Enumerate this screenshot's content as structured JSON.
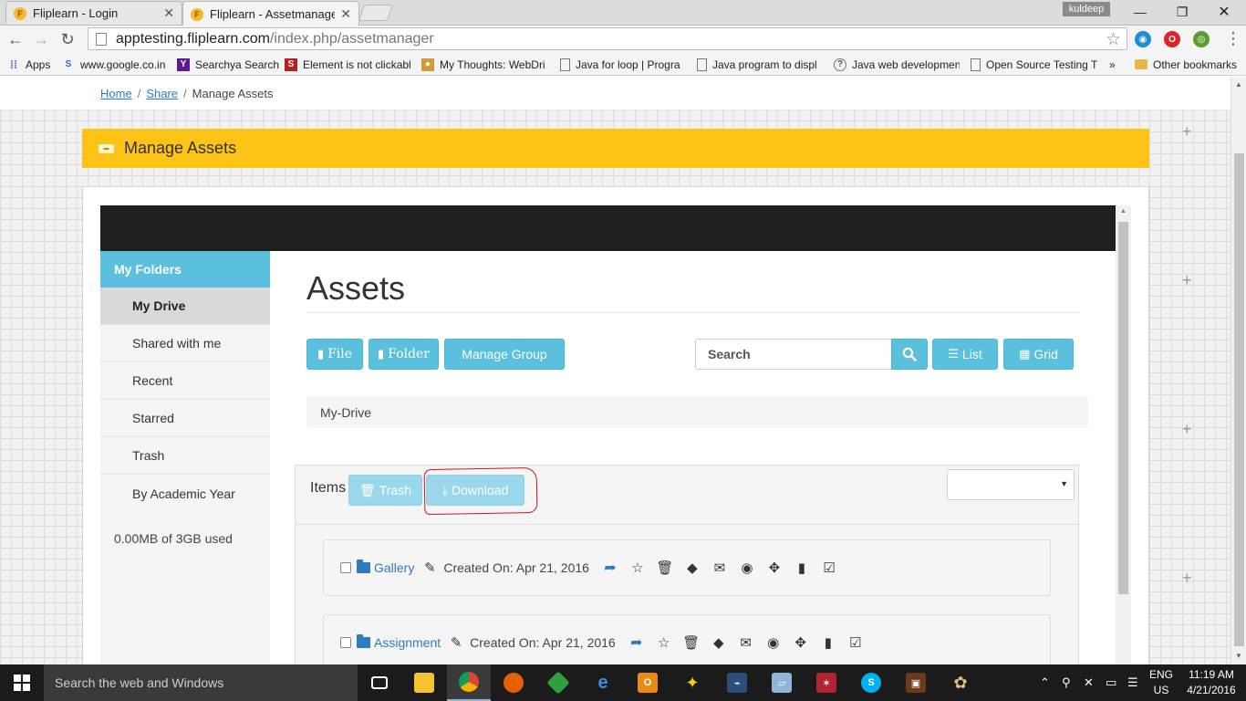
{
  "browser": {
    "tabs": [
      {
        "title": "Fliplearn - Login",
        "active": false
      },
      {
        "title": "Fliplearn - Assetmanager",
        "active": true
      }
    ],
    "profile_name": "kuldeep",
    "url_host": "apptesting.fliplearn.com",
    "url_path": "/index.php/assetmanager",
    "bookmarks": [
      {
        "label": "Apps",
        "icon": "apps-grid-icon"
      },
      {
        "label": "www.google.co.in",
        "icon": "google-icon"
      },
      {
        "label": "Searchya Search",
        "icon": "yahoo-icon"
      },
      {
        "label": "Element is not clickabl",
        "icon": "selenium-icon"
      },
      {
        "label": "My Thoughts: WebDri",
        "icon": "blog-icon"
      },
      {
        "label": "Java for loop | Progra",
        "icon": "page-icon"
      },
      {
        "label": "Java program to displ",
        "icon": "page-icon"
      },
      {
        "label": "Java web developmen",
        "icon": "question-icon"
      },
      {
        "label": "Open Source Testing T",
        "icon": "page-icon"
      }
    ],
    "bookmarks_overflow": "»",
    "other_bookmarks": "Other bookmarks"
  },
  "page": {
    "breadcrumb": {
      "home": "Home",
      "share": "Share",
      "current": "Manage Assets"
    },
    "banner_title": "Manage Assets",
    "sidebar": {
      "header": "My Folders",
      "items": [
        "My Drive",
        "Shared with me",
        "Recent",
        "Starred",
        "Trash",
        "By Academic Year"
      ],
      "active_index": 0,
      "usage": "0.00MB of 3GB used"
    },
    "main": {
      "title": "Assets",
      "buttons": {
        "file": "File",
        "folder": "Folder",
        "manage_group": "Manage Group",
        "list": "List",
        "grid": "Grid"
      },
      "search_placeholder": "Search",
      "current_path": "My-Drive",
      "items_label": "Items",
      "trash_label": "Trash",
      "download_label": "Download",
      "sort_value": "",
      "folders": [
        {
          "name": "Gallery",
          "created_label": "Created On:",
          "created_date": "Apr 21, 2016"
        },
        {
          "name": "Assignment",
          "created_label": "Created On:",
          "created_date": "Apr 21, 2016"
        }
      ]
    }
  },
  "taskbar": {
    "search_placeholder": "Search the web and Windows",
    "language": "ENG",
    "region": "US",
    "time": "11:19 AM",
    "date": "4/21/2016"
  },
  "colors": {
    "accent_info": "#5bc0de",
    "banner_yellow": "#fdc317",
    "link_blue": "#2f7bc0",
    "annotation_red": "#d6101a"
  }
}
